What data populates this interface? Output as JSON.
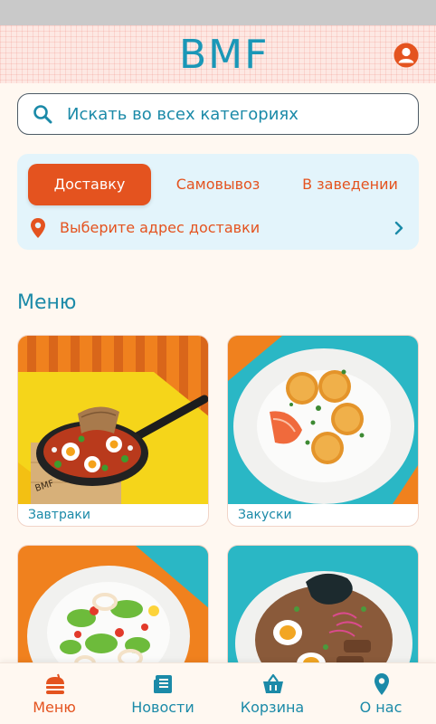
{
  "header": {
    "logo_text": "BMF",
    "profile_icon": "user-icon"
  },
  "search": {
    "placeholder": "Искать во всех категориях",
    "icon": "search-icon"
  },
  "delivery": {
    "tabs": [
      {
        "label": "Доставку",
        "active": true
      },
      {
        "label": "Самовывоз",
        "active": false
      },
      {
        "label": "В заведении",
        "active": false
      }
    ],
    "address_prompt": "Выберите адрес доставки"
  },
  "menu": {
    "title": "Меню",
    "categories": [
      {
        "label": "Завтраки"
      },
      {
        "label": "Закуски"
      },
      {
        "label": ""
      },
      {
        "label": ""
      }
    ]
  },
  "bottom_nav": {
    "items": [
      {
        "label": "Меню",
        "icon": "burger-icon",
        "active": true
      },
      {
        "label": "Новости",
        "icon": "news-icon",
        "active": false
      },
      {
        "label": "Корзина",
        "icon": "basket-icon",
        "active": false
      },
      {
        "label": "О нас",
        "icon": "location-icon",
        "active": false
      }
    ]
  },
  "colors": {
    "accent": "#e4531f",
    "brand_teal": "#1b8aa8",
    "background": "#fff8f1",
    "panel": "#e3f4fb"
  }
}
